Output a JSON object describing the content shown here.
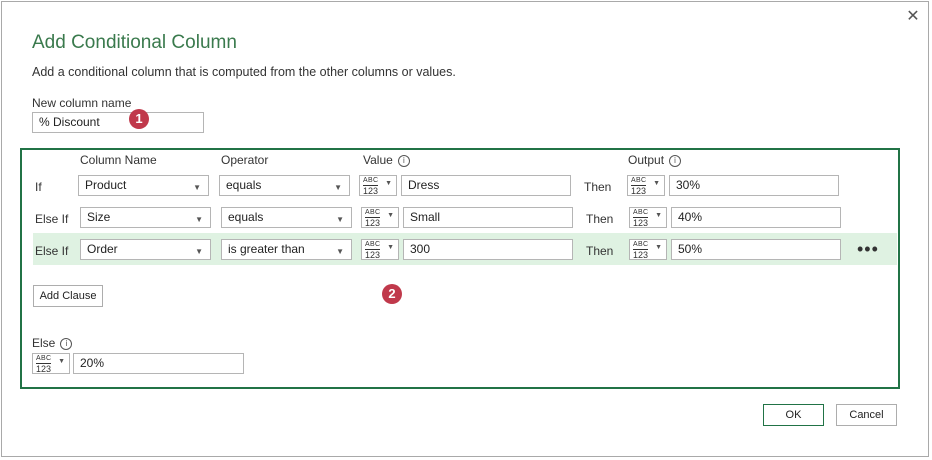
{
  "dialog": {
    "close_glyph": "✕",
    "title": "Add Conditional Column",
    "subtitle": "Add a conditional column that is computed from the other columns or values."
  },
  "new_column": {
    "label": "New column name",
    "value": "% Discount"
  },
  "badges": [
    "1",
    "2"
  ],
  "headers": {
    "column_name": "Column Name",
    "operator": "Operator",
    "value": "Value",
    "output": "Output",
    "info_glyph": "i"
  },
  "type_selector": {
    "line1": "ABC",
    "line2": "123"
  },
  "rows": [
    {
      "label": "If",
      "column": "Product",
      "operator": "equals",
      "value": "Dress",
      "then": "Then",
      "output": "30%"
    },
    {
      "label": "Else If",
      "column": "Size",
      "operator": "equals",
      "value": "Small",
      "then": "Then",
      "output": "40%"
    },
    {
      "label": "Else If",
      "column": "Order",
      "operator": "is greater than",
      "value": "300",
      "then": "Then",
      "output": "50%"
    }
  ],
  "more_glyph": "•••",
  "add_clause_label": "Add Clause",
  "else": {
    "label": "Else",
    "value": "20%"
  },
  "footer": {
    "ok_label": "OK",
    "cancel_label": "Cancel"
  },
  "colors": {
    "accent": "#217346",
    "title": "#3a7a4d",
    "badge": "#c0394b",
    "selected_row": "#dff2e2"
  }
}
